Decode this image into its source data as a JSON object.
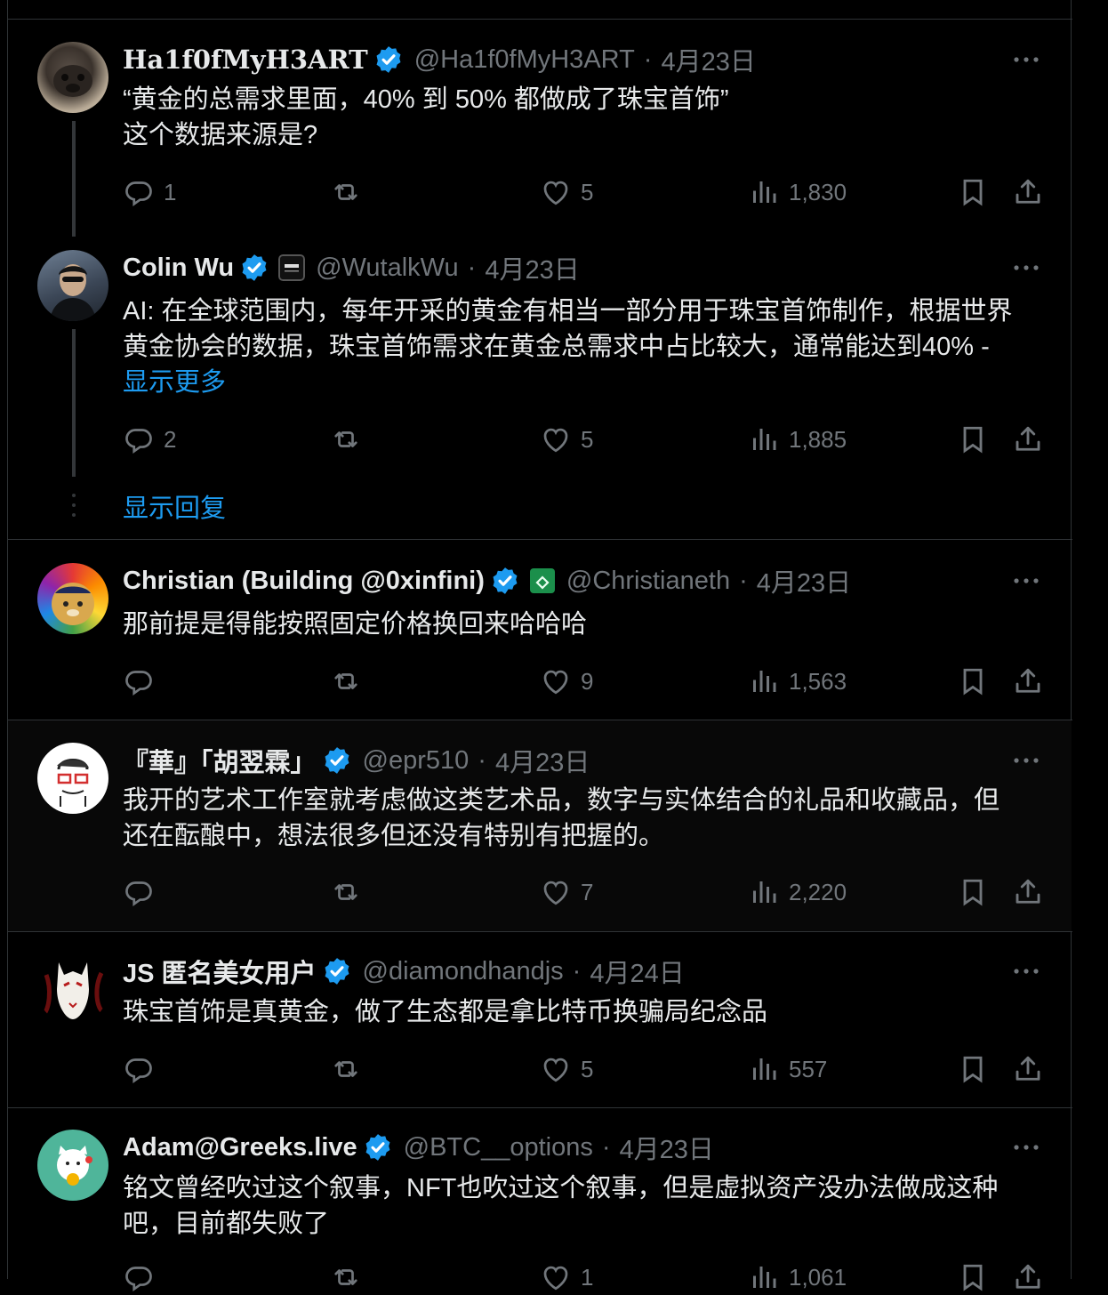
{
  "posts": [
    {
      "name": "Ha1f0fMyH3ART",
      "handle": "@Ha1f0fMyH3ART",
      "date": "4月23日",
      "text": [
        "“黄金的总需求里面，40% 到 50% 都做成了珠宝首饰”",
        "这个数据来源是?"
      ],
      "replies": "1",
      "likes": "5",
      "views": "1,830"
    },
    {
      "name": "Colin Wu",
      "handle": "@WutalkWu",
      "date": "4月23日",
      "text": [
        "AI: 在全球范围内，每年开采的黄金有相当一部分用于珠宝首饰制作，根据世界",
        "黄金协会的数据，珠宝首饰需求在黄金总需求中占比较大，通常能达到40% -"
      ],
      "show_more": "显示更多",
      "replies": "2",
      "likes": "5",
      "views": "1,885"
    },
    {
      "name": "Christian (Building @0xinfini)",
      "handle": "@Christianeth",
      "date": "4月23日",
      "text": [
        "那前提是得能按照固定价格换回来哈哈哈"
      ],
      "replies": "",
      "likes": "9",
      "views": "1,563"
    },
    {
      "name": "『華』「胡翌霖」",
      "handle": "@epr510",
      "date": "4月23日",
      "text": [
        "我开的艺术工作室就考虑做这类艺术品，数字与实体结合的礼品和收藏品，但",
        "还在酝酿中，想法很多但还没有特别有把握的。"
      ],
      "replies": "",
      "likes": "7",
      "views": "2,220"
    },
    {
      "name": "JS 匿名美女用户",
      "handle": "@diamondhandjs",
      "date": "4月24日",
      "text": [
        "珠宝首饰是真黄金，做了生态都是拿比特币换骗局纪念品"
      ],
      "replies": "",
      "likes": "5",
      "views": "557"
    },
    {
      "name": "Adam@Greeks.live",
      "handle": "@BTC__options",
      "date": "4月23日",
      "text": [
        "铭文曾经吹过这个叙事，NFT也吹过这个叙事，但是虚拟资产没办法做成这种",
        "吧，目前都失败了"
      ],
      "replies": "",
      "likes": "1",
      "views": "1,061"
    }
  ],
  "show_replies": "显示回复",
  "separator": "·",
  "colors": {
    "background": "#000000",
    "text": "#e7e9ea",
    "muted": "#71767b",
    "accent": "#1d9bf0",
    "border": "#2f3336"
  },
  "icons": [
    "reply-icon",
    "repost-icon",
    "like-icon",
    "views-icon",
    "bookmark-icon",
    "share-icon",
    "more-icon",
    "verified-badge-icon"
  ]
}
